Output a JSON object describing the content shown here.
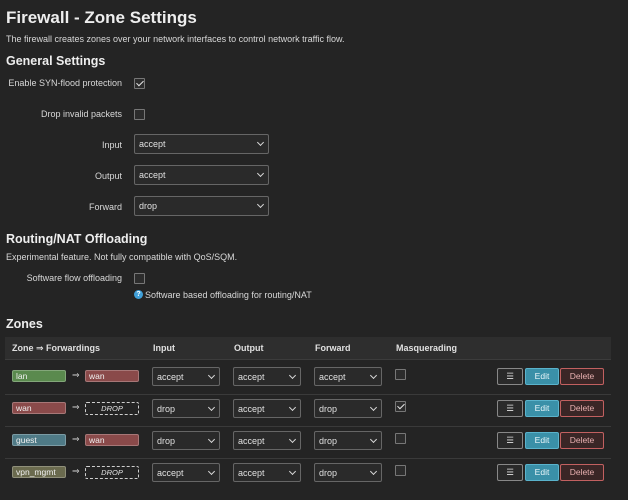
{
  "page": {
    "title": "Firewall - Zone Settings",
    "description": "The firewall creates zones over your network interfaces to control network traffic flow."
  },
  "general": {
    "heading": "General Settings",
    "syn_flood": {
      "label": "Enable SYN-flood protection",
      "checked": true
    },
    "drop_invalid": {
      "label": "Drop invalid packets",
      "checked": false
    },
    "input": {
      "label": "Input",
      "value": "accept"
    },
    "output": {
      "label": "Output",
      "value": "accept"
    },
    "forward": {
      "label": "Forward",
      "value": "drop"
    }
  },
  "offloading": {
    "heading": "Routing/NAT Offloading",
    "description": "Experimental feature. Not fully compatible with QoS/SQM.",
    "software": {
      "label": "Software flow offloading",
      "checked": false
    },
    "help_text": "Software based offloading for routing/NAT"
  },
  "zones": {
    "heading": "Zones",
    "columns": {
      "zone": "Zone ⇒ Forwardings",
      "input": "Input",
      "output": "Output",
      "forward": "Forward",
      "masq": "Masquerading"
    },
    "arrow": "⇒",
    "rows": [
      {
        "name": "lan",
        "color": "#5a8a4e",
        "forward_to": "wan",
        "forward_color": "#8a4a4a",
        "forward_drop": false,
        "input": "accept",
        "output": "accept",
        "forward": "accept",
        "masq": false
      },
      {
        "name": "wan",
        "color": "#8a4a4a",
        "forward_to": "DROP",
        "forward_color": "",
        "forward_drop": true,
        "input": "drop",
        "output": "accept",
        "forward": "drop",
        "masq": true
      },
      {
        "name": "guest",
        "color": "#4f7a86",
        "forward_to": "wan",
        "forward_color": "#8a4a4a",
        "forward_drop": false,
        "input": "drop",
        "output": "accept",
        "forward": "drop",
        "masq": false
      },
      {
        "name": "vpn_mgmt",
        "color": "#6a6a4e",
        "forward_to": "DROP",
        "forward_color": "",
        "forward_drop": true,
        "input": "accept",
        "output": "accept",
        "forward": "drop",
        "masq": false
      }
    ],
    "menu_label": "☰",
    "edit_label": "Edit",
    "delete_label": "Delete"
  }
}
